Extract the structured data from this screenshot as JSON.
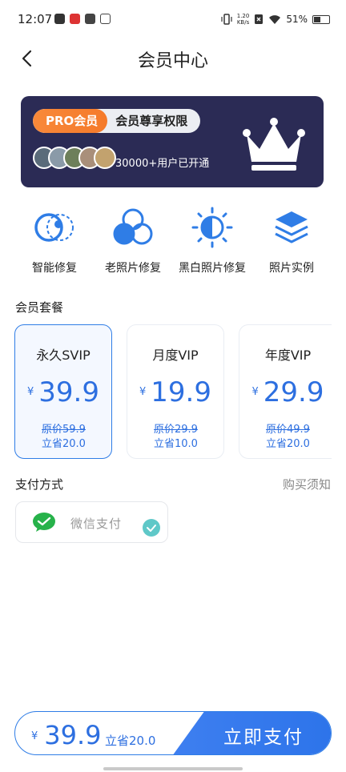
{
  "status": {
    "time": "12:07",
    "net_speed_top": "1.20",
    "net_speed_bottom": "KB/s",
    "battery": "51%"
  },
  "nav": {
    "title": "会员中心"
  },
  "banner": {
    "pro_label": "PRO会员",
    "privilege_label": "会员尊享权限",
    "user_count": "30000+用户已开通",
    "accent": "#f8893a",
    "bg": "#2b2b55"
  },
  "features": [
    {
      "label": "智能修复",
      "icon": "smart-repair-icon"
    },
    {
      "label": "老照片修复",
      "icon": "old-photo-repair-icon"
    },
    {
      "label": "黑白照片修复",
      "icon": "bw-photo-repair-icon"
    },
    {
      "label": "照片实例",
      "icon": "photo-examples-icon"
    }
  ],
  "plans_title": "会员套餐",
  "plans": [
    {
      "name": "永久SVIP",
      "currency": "¥",
      "price": "39.9",
      "original": "原价59.9",
      "save": "立省20.0",
      "selected": true
    },
    {
      "name": "月度VIP",
      "currency": "¥",
      "price": "19.9",
      "original": "原价29.9",
      "save": "立省10.0",
      "selected": false
    },
    {
      "name": "年度VIP",
      "currency": "¥",
      "price": "29.9",
      "original": "原价49.9",
      "save": "立省20.0",
      "selected": false
    }
  ],
  "payment": {
    "title": "支付方式",
    "notice": "购买须知",
    "method": "微信支付",
    "icon": "wechat-pay-icon"
  },
  "bottom": {
    "currency": "¥",
    "price": "39.9",
    "save": "立省20.0",
    "pay_label": "立即支付"
  },
  "colors": {
    "primary": "#2d6fe0",
    "check": "#5fc8c8"
  }
}
